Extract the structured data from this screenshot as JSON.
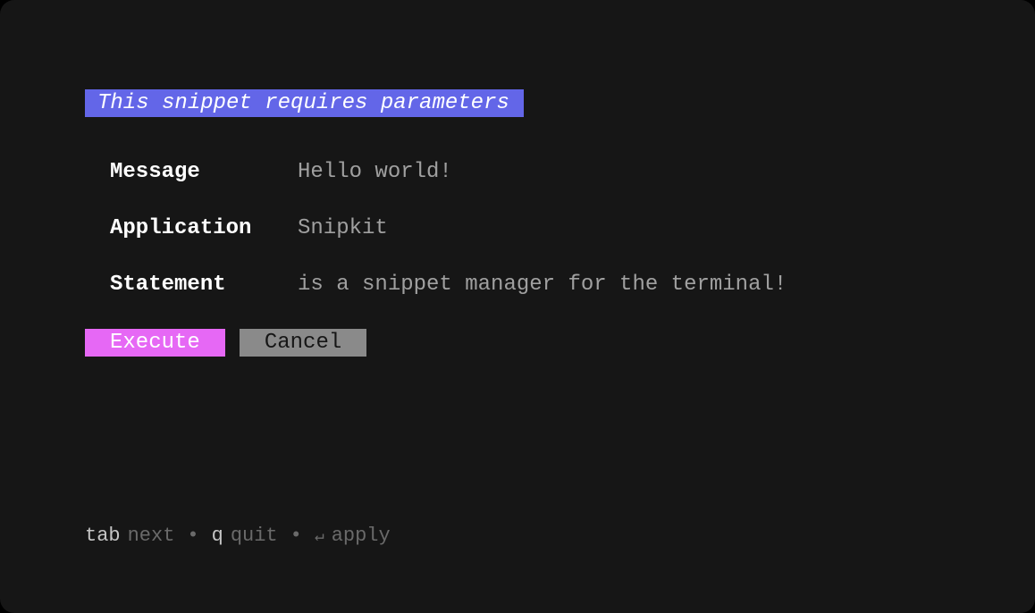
{
  "title": "This snippet requires parameters",
  "parameters": [
    {
      "label": "Message",
      "value": "Hello world!"
    },
    {
      "label": "Application",
      "value": "Snipkit"
    },
    {
      "label": "Statement",
      "value": "is a snippet manager for the terminal!"
    }
  ],
  "buttons": {
    "execute": "Execute",
    "cancel": "Cancel"
  },
  "hints": {
    "tab_key": "tab",
    "tab_action": "next",
    "q_key": "q",
    "q_action": "quit",
    "enter_symbol": "↵",
    "enter_action": "apply",
    "separator": "•"
  }
}
